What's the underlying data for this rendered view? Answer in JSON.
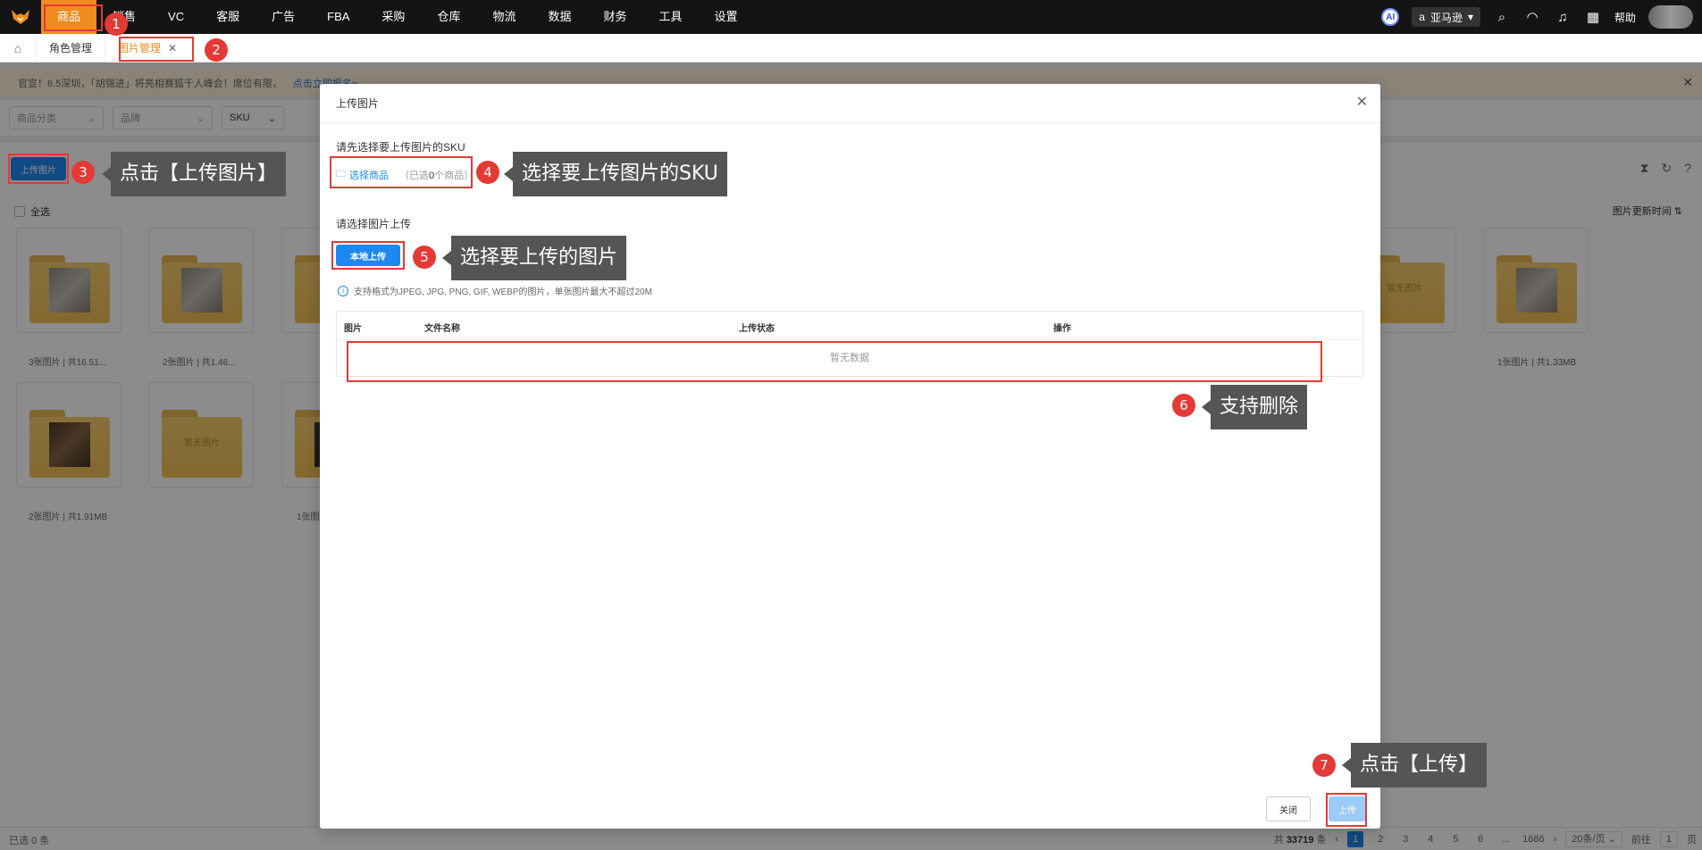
{
  "topnav": {
    "items": [
      "商品",
      "销售",
      "VC",
      "客服",
      "广告",
      "FBA",
      "采购",
      "仓库",
      "物流",
      "数据",
      "财务",
      "工具",
      "设置"
    ],
    "ai_label": "AI",
    "store": "亚马逊",
    "help": "帮助"
  },
  "tabs": {
    "items": [
      {
        "label": "角色管理"
      },
      {
        "label": "图片管理"
      }
    ]
  },
  "notice": {
    "text": "官宣！6.5深圳，「胡锡进」将亮相赛狐千人峰会！席位有限，",
    "link": "点击立即报名»"
  },
  "filters": {
    "category": "商品分类",
    "brand": "品牌",
    "sku": "SKU"
  },
  "toolbar": {
    "upload_label": "上传图片",
    "select_all": "全选",
    "sort": "图片更新时间"
  },
  "cards": [
    {
      "caption": "3张图片 | 共16.51..."
    },
    {
      "caption": "2张图片 | 共1.46..."
    },
    {
      "caption": ""
    },
    {
      "caption": ""
    },
    {
      "caption": "1张图片 | 共1.33MB",
      "empty": ""
    },
    {
      "caption": "2张图片 | 共1.91MB"
    },
    {
      "caption": "",
      "empty": "暂无图片"
    },
    {
      "caption": "1张图"
    }
  ],
  "empty_folder": "暂无图片",
  "status": {
    "selected": "已选 0 条",
    "total_prefix": "共",
    "total": "33719",
    "total_suffix": "条",
    "pages": [
      "1",
      "2",
      "3",
      "4",
      "5",
      "6",
      "...",
      "1686"
    ],
    "per_page": "20条/页",
    "goto_prefix": "前往",
    "goto_value": "1",
    "goto_suffix": "页"
  },
  "modal": {
    "title": "上传图片",
    "sku_section": "请先选择要上传图片的SKU",
    "select_product": "选择商品",
    "selected_note_prefix": "（已选",
    "selected_count": "0",
    "selected_note_suffix": "个商品）",
    "upload_section": "请选择图片上传",
    "local_upload": "本地上传",
    "tip": "支持格式为JPEG, JPG, PNG, GIF, WEBP的图片，单张图片最大不超过20M",
    "table_headers": [
      "图片",
      "文件名称",
      "上传状态",
      "操作"
    ],
    "empty": "暂无数据",
    "close_btn": "关闭",
    "upload_btn": "上传"
  },
  "annotations": {
    "numbers": [
      "1",
      "2",
      "3",
      "4",
      "5",
      "6",
      "7"
    ],
    "callouts": [
      "点击【上传图片】",
      "选择要上传图片的SKU",
      "选择要上传的图片",
      "支持删除",
      "点击【上传】"
    ]
  },
  "colors": {
    "brand": "#f08c1f",
    "primary": "#1e88f0",
    "annotation": "#e53935"
  }
}
